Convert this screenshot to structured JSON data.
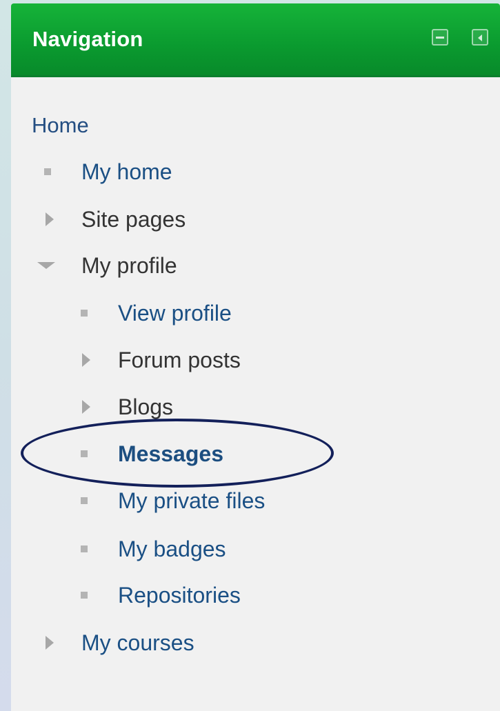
{
  "block": {
    "title": "Navigation",
    "controls": [
      {
        "icon": "minimize-icon"
      },
      {
        "icon": "dock-icon"
      }
    ]
  },
  "nav": {
    "home": "Home",
    "my_home": "My home",
    "site_pages": "Site pages",
    "my_profile": "My profile",
    "view_profile": "View profile",
    "forum_posts": "Forum posts",
    "blogs": "Blogs",
    "messages": "Messages",
    "my_private_files": "My private files",
    "my_badges": "My badges",
    "repositories": "Repositories",
    "my_courses": "My courses"
  },
  "colors": {
    "header": "#0a9a2f",
    "link": "#1a4f84",
    "highlight": "#13205a"
  }
}
